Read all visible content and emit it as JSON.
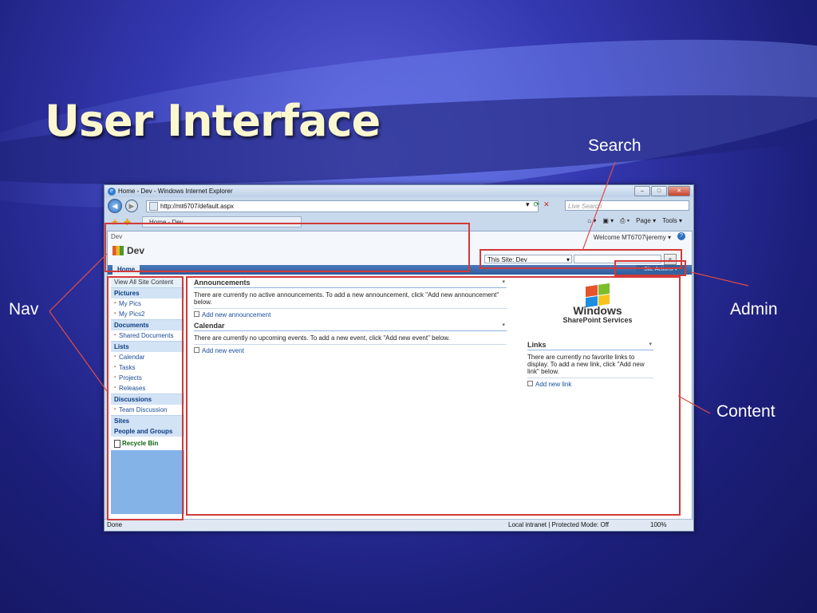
{
  "slide": {
    "title": "User Interface",
    "callouts": {
      "search": "Search",
      "nav": "Nav",
      "admin": "Admin",
      "content": "Content"
    },
    "highlight_color": "#d23a3a"
  },
  "browser": {
    "window_title": "Home - Dev - Windows Internet Explorer",
    "url": "http://mt6707/default.aspx",
    "live_search_placeholder": "Live Search",
    "tab_title": "Home - Dev",
    "commands": {
      "page": "Page ▾",
      "tools": "Tools ▾"
    },
    "status": {
      "done": "Done",
      "zone": "Local intranet | Protected Mode: Off",
      "zoom": "100%"
    }
  },
  "sharepoint": {
    "breadcrumb": "Dev",
    "welcome": "Welcome MT6707\\jeremy ▾",
    "site_name": "Dev",
    "home_tab": "Home",
    "search_scope": "This Site: Dev",
    "site_actions": "Site Actions ▾",
    "nav": {
      "view_all": "View All Site Content",
      "pictures_heading": "Pictures",
      "pictures": [
        "My Pics",
        "My Pics2"
      ],
      "documents_heading": "Documents",
      "documents": [
        "Shared Documents"
      ],
      "lists_heading": "Lists",
      "lists": [
        "Calendar",
        "Tasks",
        "Projects",
        "Releases"
      ],
      "discussions_heading": "Discussions",
      "discussions": [
        "Team Discussion"
      ],
      "sites": "Sites",
      "people": "People and Groups",
      "recycle": "Recycle Bin"
    },
    "announcements": {
      "title": "Announcements",
      "body": "There are currently no active announcements. To add a new announcement, click \"Add new announcement\" below.",
      "link": "Add new announcement"
    },
    "calendar": {
      "title": "Calendar",
      "body": "There are currently no upcoming events. To add a new event, click \"Add new event\" below.",
      "link": "Add new event"
    },
    "logo": {
      "line1": "Windows",
      "line2": "SharePoint Services"
    },
    "links": {
      "title": "Links",
      "body": "There are currently no favorite links to display. To add a new link, click \"Add new link\" below.",
      "link": "Add new link"
    }
  }
}
